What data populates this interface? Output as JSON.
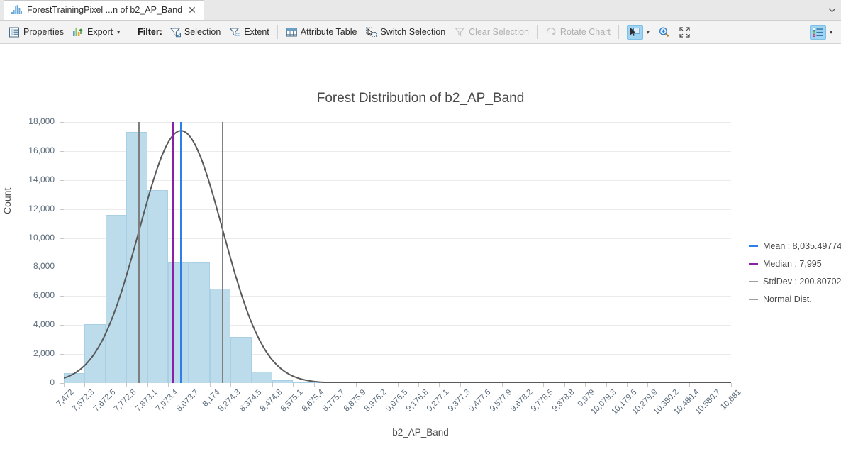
{
  "tab": {
    "title": "ForestTrainingPixel ...n of b2_AP_Band",
    "close_label": "✕",
    "icon": "histogram-icon",
    "overflow_icon": "chevron-down-icon"
  },
  "toolbar": {
    "properties_label": "Properties",
    "export_label": "Export",
    "export_caret": "▾",
    "filter_label": "Filter:",
    "selection_label": "Selection",
    "extent_label": "Extent",
    "attribute_table_label": "Attribute Table",
    "switch_selection_label": "Switch Selection",
    "clear_selection_label": "Clear Selection",
    "rotate_chart_label": "Rotate Chart",
    "pointer_caret": "▾",
    "legend_caret": "▾",
    "icons": {
      "properties": "properties-icon",
      "export": "export-icon",
      "filter_selection": "filter-selection-icon",
      "filter_extent": "filter-extent-icon",
      "attribute_table": "table-icon",
      "switch_selection": "switch-selection-icon",
      "clear_selection": "clear-selection-icon",
      "rotate_chart": "rotate-chart-icon",
      "pointer": "selection-pointer-icon",
      "zoom": "zoom-in-icon",
      "full_extent": "full-extent-icon",
      "legend": "legend-list-icon"
    }
  },
  "colors": {
    "bar_fill": "#bcdcec",
    "bar_stroke": "#a8cfe3",
    "mean": "#2d7fe8",
    "median": "#8a1fa8",
    "stddev": "#7f7f7f",
    "normal_dist": "#595959",
    "grid": "#ebebeb",
    "tick_text": "#5b6b7b",
    "highlight": "#9fd5f3"
  },
  "legend": [
    {
      "label": "Mean : 8,035.49774",
      "color": "#2d7fe8",
      "name": "legend-mean"
    },
    {
      "label": "Median : 7,995",
      "color": "#8a1fa8",
      "name": "legend-median"
    },
    {
      "label": "StdDev : 200.80702",
      "color": "#9e9e9e",
      "name": "legend-stddev"
    },
    {
      "label": "Normal Dist.",
      "color": "#9e9e9e",
      "name": "legend-normal-dist"
    }
  ],
  "chart_data": {
    "type": "bar",
    "title": "Forest Distribution of b2_AP_Band",
    "xlabel": "b2_AP_Band",
    "ylabel": "Count",
    "grid": true,
    "legend_position": "right",
    "ylim": [
      0,
      18000
    ],
    "yticks": [
      0,
      2000,
      4000,
      6000,
      8000,
      10000,
      12000,
      14000,
      16000,
      18000
    ],
    "ytick_labels": [
      "0",
      "2,000",
      "4,000",
      "6,000",
      "8,000",
      "10,000",
      "12,000",
      "14,000",
      "16,000",
      "18,000"
    ],
    "xtick_labels": [
      "7,472",
      "7,572.3",
      "7,672.6",
      "7,772.8",
      "7,873.1",
      "7,973.4",
      "8,073.7",
      "8,174",
      "8,274.3",
      "8,374.5",
      "8,474.8",
      "8,575.1",
      "8,675.4",
      "8,775.7",
      "8,875.9",
      "8,976.2",
      "9,076.5",
      "9,176.8",
      "9,277.1",
      "9,377.3",
      "9,477.6",
      "9,577.9",
      "9,678.2",
      "9,778.5",
      "9,878.8",
      "9,979",
      "10,079.3",
      "10,179.6",
      "10,279.9",
      "10,380.2",
      "10,480.4",
      "10,580.7",
      "10,681"
    ],
    "bin_edges": [
      7472,
      7572.3,
      7672.6,
      7772.8,
      7873.1,
      7973.4,
      8073.7,
      8174,
      8274.3,
      8374.5,
      8474.8,
      8575.1,
      8675.4,
      8775.7,
      8875.9,
      8976.2,
      9076.5,
      9176.8,
      9277.1,
      9377.3,
      9477.6,
      9577.9,
      9678.2,
      9778.5,
      9878.8,
      9979,
      10079.3,
      10179.6,
      10279.9,
      10380.2,
      10480.4,
      10580.7,
      10681
    ],
    "values": [
      700,
      4050,
      11600,
      17300,
      13300,
      8300,
      8300,
      6500,
      3200,
      800,
      180,
      60,
      30,
      10,
      0,
      0,
      0,
      0,
      0,
      0,
      0,
      0,
      0,
      0,
      0,
      0,
      0,
      0,
      0,
      0,
      0,
      0
    ],
    "markers": {
      "mean": 8035.49774,
      "median": 7995,
      "stddev": 200.80702,
      "stddev_low": 7834.69,
      "stddev_high": 8236.3
    },
    "normal_curve": {
      "mu": 8035.49774,
      "sigma": 200.80702,
      "peak_count": 17400
    }
  }
}
